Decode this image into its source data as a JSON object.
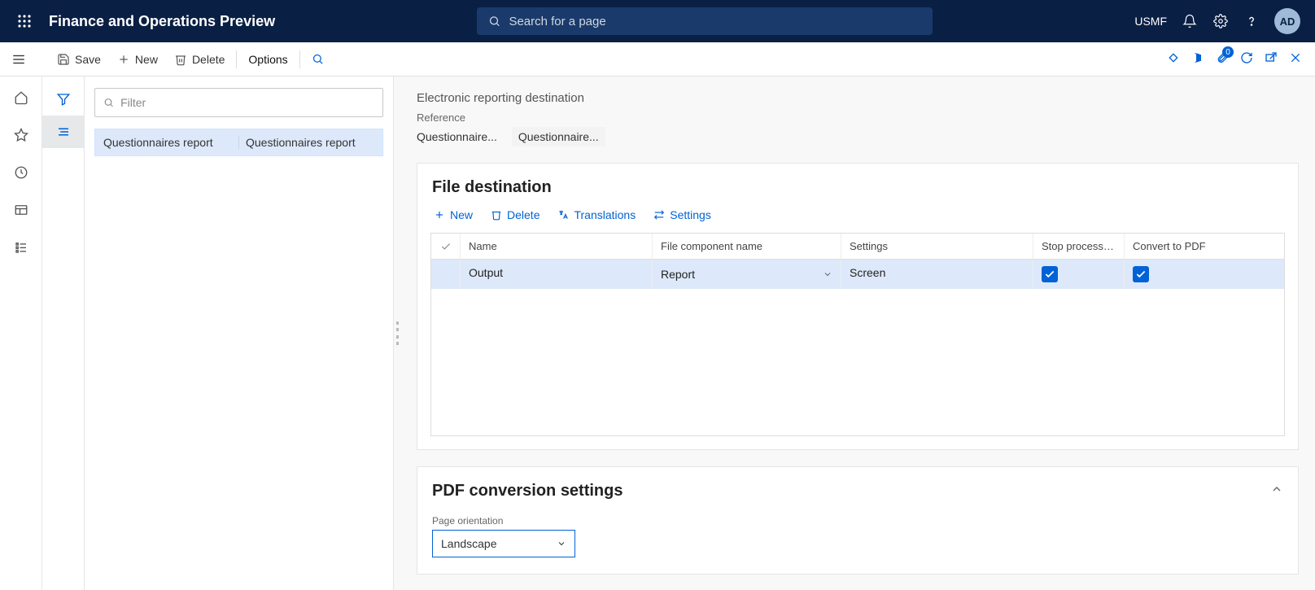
{
  "header": {
    "app_title": "Finance and Operations Preview",
    "search_placeholder": "Search for a page",
    "company": "USMF",
    "avatar": "AD",
    "badge_count": "0"
  },
  "actionbar": {
    "save": "Save",
    "new": "New",
    "delete": "Delete",
    "options": "Options"
  },
  "filter_placeholder": "Filter",
  "list": {
    "col1": "Questionnaires report",
    "col2": "Questionnaires report"
  },
  "page": {
    "title": "Electronic reporting destination",
    "reference_label": "Reference",
    "ref1": "Questionnaire...",
    "ref2": "Questionnaire..."
  },
  "file_destination": {
    "header": "File destination",
    "toolbar": {
      "new": "New",
      "delete": "Delete",
      "translations": "Translations",
      "settings": "Settings"
    },
    "columns": {
      "name": "Name",
      "component": "File component name",
      "settings": "Settings",
      "stop": "Stop processin...",
      "convert": "Convert to PDF"
    },
    "row": {
      "name": "Output",
      "component": "Report",
      "settings": "Screen"
    }
  },
  "pdf_section": {
    "header": "PDF conversion settings",
    "field_label": "Page orientation",
    "value": "Landscape"
  }
}
